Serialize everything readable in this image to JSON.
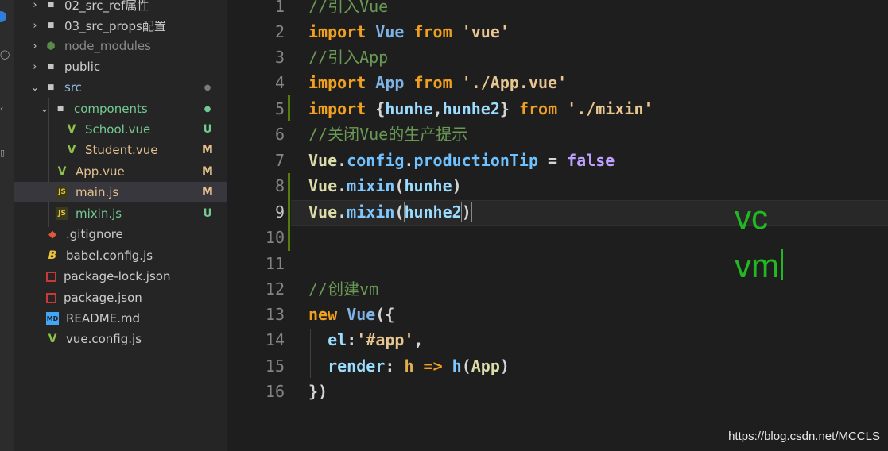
{
  "explorer": {
    "items": [
      {
        "label": "02_src_ref属性",
        "type": "folder",
        "expanded": false,
        "status": ""
      },
      {
        "label": "03_src_props配置",
        "type": "folder",
        "expanded": false,
        "status": ""
      },
      {
        "label": "node_modules",
        "type": "folder-node",
        "expanded": false,
        "status": ""
      },
      {
        "label": "public",
        "type": "folder",
        "expanded": false,
        "status": ""
      },
      {
        "label": "src",
        "type": "folder",
        "expanded": true,
        "status": "●"
      },
      {
        "label": "components",
        "type": "folder",
        "expanded": true,
        "status": "●"
      },
      {
        "label": "School.vue",
        "type": "vue",
        "status": "U"
      },
      {
        "label": "Student.vue",
        "type": "vue",
        "status": "M"
      },
      {
        "label": "App.vue",
        "type": "vue",
        "status": "M"
      },
      {
        "label": "main.js",
        "type": "js",
        "status": "M"
      },
      {
        "label": "mixin.js",
        "type": "js",
        "status": "U"
      },
      {
        "label": ".gitignore",
        "type": "git",
        "status": ""
      },
      {
        "label": "babel.config.js",
        "type": "babel",
        "status": ""
      },
      {
        "label": "package-lock.json",
        "type": "npm",
        "status": ""
      },
      {
        "label": "package.json",
        "type": "npm",
        "status": ""
      },
      {
        "label": "README.md",
        "type": "md",
        "status": ""
      },
      {
        "label": "vue.config.js",
        "type": "vue",
        "status": ""
      }
    ],
    "icons": {
      "js": "JS",
      "md": "MD",
      "babel": "B"
    }
  },
  "editor": {
    "line_numbers": [
      "1",
      "2",
      "3",
      "4",
      "5",
      "6",
      "7",
      "8",
      "9",
      "10",
      "11",
      "12",
      "13",
      "14",
      "15",
      "16"
    ],
    "code": {
      "l1": "//引入Vue",
      "l2_kw": "import",
      "l2_id": "Vue",
      "l2_from": "from",
      "l2_str": "'vue'",
      "l3": "//引入App",
      "l4_kw": "import",
      "l4_id": "App",
      "l4_from": "from",
      "l4_str": "'./App.vue'",
      "l5_kw": "import",
      "l5_open": "{",
      "l5_a": "hunhe",
      "l5_comma": ",",
      "l5_b": "hunhe2",
      "l5_close": "}",
      "l5_from": "from",
      "l5_str": "'./mixin'",
      "l6": "//关闭Vue的生产提示",
      "l7_obj": "Vue",
      "l7_dot1": ".",
      "l7_config": "config",
      "l7_dot2": ".",
      "l7_prop": "productionTip",
      "l7_eq": " = ",
      "l7_val": "false",
      "l8_obj": "Vue",
      "l8_dot": ".",
      "l8_fn": "mixin",
      "l8_open": "(",
      "l8_arg": "hunhe",
      "l8_close": ")",
      "l9_obj": "Vue",
      "l9_dot": ".",
      "l9_fn": "mixin",
      "l9_open": "(",
      "l9_arg": "hunhe2",
      "l9_close": ")",
      "l12": "//创建vm",
      "l13_kw": "new",
      "l13_id": "Vue",
      "l13_rest": "({",
      "l14_key": "el",
      "l14_colon": ":",
      "l14_str": "'#app'",
      "l14_comma": ",",
      "l15_key": "render",
      "l15_colon": ": ",
      "l15_h": "h",
      "l15_arrow": " => ",
      "l15_fn": "h",
      "l15_open": "(",
      "l15_arg": "App",
      "l15_close": ")",
      "l16": "})"
    }
  },
  "annotation": {
    "line1": "vc",
    "line2": "vm"
  },
  "watermark": "https://blog.csdn.net/MCCLS",
  "colors": {
    "accent": "#2f7ed8",
    "annotation": "#22b822",
    "modified": "#e2c08d",
    "untracked": "#73c991"
  }
}
